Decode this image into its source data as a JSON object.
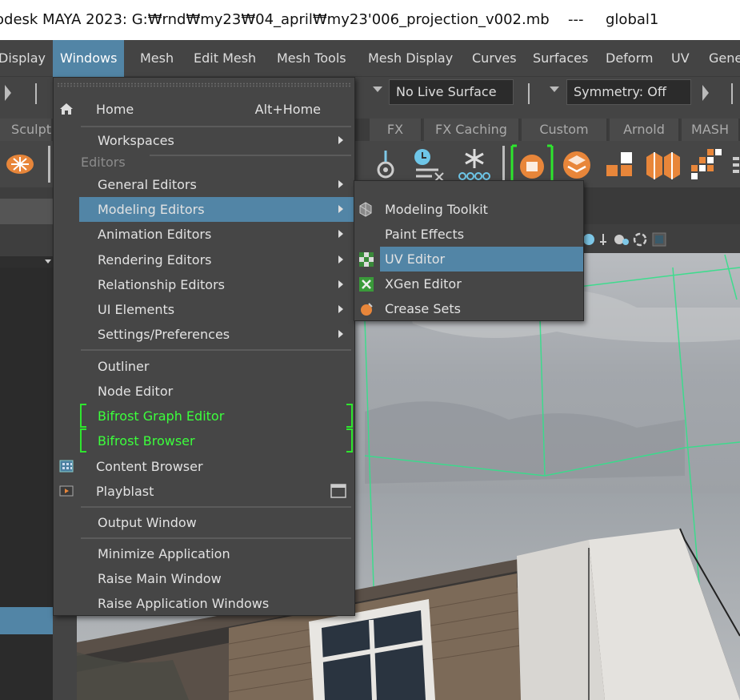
{
  "titlebar": {
    "title": "odesk MAYA 2023: G:₩rnd₩my23₩04_april₩my23'006_projection_v002.mb",
    "separator": "---",
    "object": "global1"
  },
  "menubar": {
    "items": [
      "Display",
      "Windows",
      "Mesh",
      "Edit Mesh",
      "Mesh Tools",
      "Mesh Display",
      "Curves",
      "Surfaces",
      "Deform",
      "UV",
      "Gene"
    ],
    "active": "Windows"
  },
  "statusline": {
    "live_surface": "No Live Surface",
    "symmetry": "Symmetry: Off"
  },
  "shelf_tabs": [
    "Sculpt",
    "FX",
    "FX Caching",
    "Custom",
    "Arnold",
    "MASH"
  ],
  "windows_menu": {
    "home": {
      "label": "Home",
      "shortcut": "Alt+Home"
    },
    "workspaces": "Workspaces",
    "section_editors": "Editors",
    "editors": [
      "General Editors",
      "Modeling Editors",
      "Animation Editors",
      "Rendering Editors",
      "Relationship Editors",
      "UI Elements",
      "Settings/Preferences"
    ],
    "highlighted": "Modeling Editors",
    "tools": [
      "Outliner",
      "Node Editor",
      "Bifrost Graph Editor",
      "Bifrost Browser",
      "Content Browser",
      "Playblast"
    ],
    "output": "Output Window",
    "window_actions": [
      "Minimize Application",
      "Raise Main Window",
      "Raise Application Windows"
    ]
  },
  "modeling_submenu": {
    "items": [
      "Modeling Toolkit",
      "Paint Effects",
      "UV Editor",
      "XGen Editor",
      "Crease Sets"
    ],
    "highlighted": "UV Editor"
  },
  "colors": {
    "highlight": "#5285a6",
    "bifrost_green": "#3cff3c",
    "menu_bg": "#464646"
  }
}
